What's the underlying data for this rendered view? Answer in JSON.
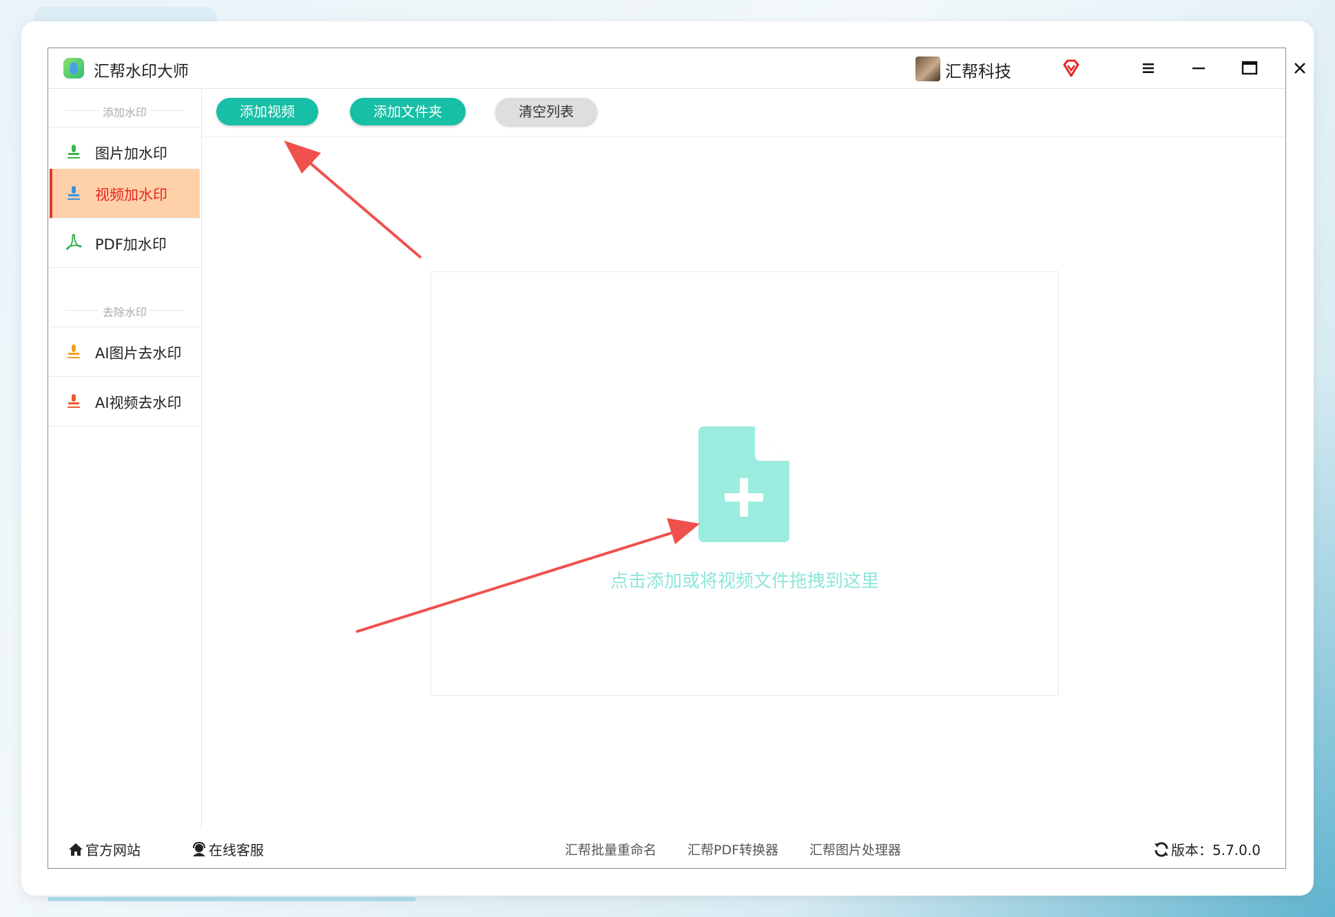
{
  "window": {
    "title": "汇帮水印大师",
    "user_name": "汇帮科技",
    "accent_color": "#16bfa5",
    "active_color": "#e8231f"
  },
  "window_controls": [
    "menu-icon",
    "minimize-icon",
    "maximize-icon",
    "close-icon"
  ],
  "sidebar": {
    "section_add": "添加水印",
    "section_remove": "去除水印",
    "items": [
      {
        "label": "图片加水印",
        "icon": "image-stamp-icon",
        "active": false
      },
      {
        "label": "视频加水印",
        "icon": "video-stamp-icon",
        "active": true
      },
      {
        "label": "PDF加水印",
        "icon": "pdf-icon",
        "active": false
      },
      {
        "label": "AI图片去水印",
        "icon": "ai-image-stamp-icon",
        "active": false
      },
      {
        "label": "AI视频去水印",
        "icon": "ai-video-stamp-icon",
        "active": false
      }
    ]
  },
  "toolbar": {
    "add_video": "添加视频",
    "add_folder": "添加文件夹",
    "clear_list": "清空列表"
  },
  "dropzone": {
    "text": "点击添加或将视频文件拖拽到这里",
    "icon": "add-file-icon"
  },
  "statusbar": {
    "website": "官方网站",
    "support": "在线客服",
    "links": [
      "汇帮批量重命名",
      "汇帮PDF转换器",
      "汇帮图片处理器"
    ],
    "version_label": "版本：",
    "version": "5.7.0.0"
  },
  "annotations": {
    "arrow_color": "#f0504d"
  }
}
